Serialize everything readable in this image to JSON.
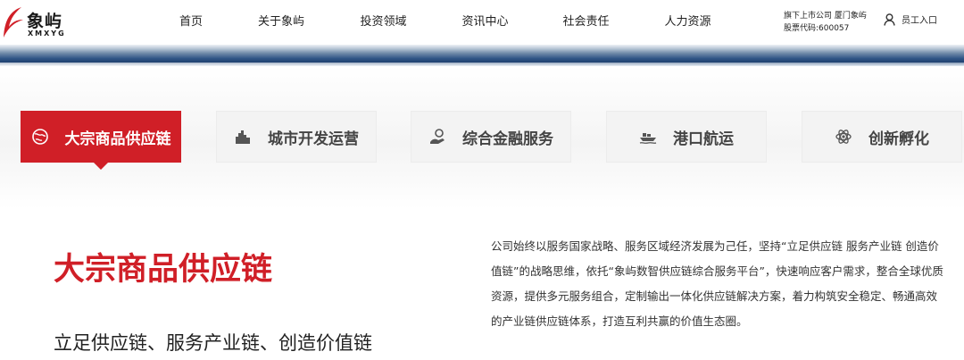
{
  "brand": {
    "name_cn": "象屿",
    "name_en": "XMXYG",
    "accent": "#d01f27"
  },
  "nav": {
    "items": [
      {
        "label": "首页"
      },
      {
        "label": "关于象屿"
      },
      {
        "label": "投资领域"
      },
      {
        "label": "资讯中心"
      },
      {
        "label": "社会责任"
      },
      {
        "label": "人力资源"
      }
    ]
  },
  "stock": {
    "line1": "旗下上市公司 厦门象屿",
    "line2": "股票代码:600057"
  },
  "staff": {
    "label": "员工入口",
    "icon": "user-icon"
  },
  "tabs": [
    {
      "label": "大宗商品供应链",
      "icon": "globe-icon",
      "active": true
    },
    {
      "label": "城市开发运营",
      "icon": "city-icon",
      "active": false
    },
    {
      "label": "综合金融服务",
      "icon": "finance-icon",
      "active": false
    },
    {
      "label": "港口航运",
      "icon": "ship-icon",
      "active": false
    },
    {
      "label": "创新孵化",
      "icon": "atom-icon",
      "active": false
    }
  ],
  "content": {
    "title": "大宗商品供应链",
    "subtitle": "立足供应链、服务产业链、创造价值链",
    "description": "公司始终以服务国家战略、服务区域经济发展为己任，坚持“立足供应链 服务产业链 创造价值链”的战略思维，依托“象屿数智供应链综合服务平台”，快速响应客户需求，整合全球优质资源，提供多元服务组合，定制输出一体化供应链解决方案，着力构筑安全稳定、畅通高效的产业链供应链体系，打造互利共赢的价值生态圈。"
  }
}
